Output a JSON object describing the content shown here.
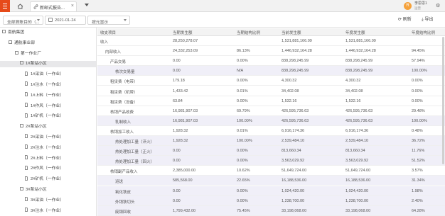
{
  "topbar": {
    "tab_label": "新邮式报告...",
    "user_name": "李思思1",
    "user_role": "运营",
    "avatar_text": "R",
    "accent": "#e64a19"
  },
  "filters": {
    "org_select": "全部算账目的（...",
    "date": "2021-01-24",
    "display_select": "按元显示",
    "refresh_label": "刷新",
    "export_label": "导出"
  },
  "tree": [
    {
      "label": "南航集团",
      "level": 0,
      "type": "box"
    },
    {
      "label": "通航事业部",
      "level": 1,
      "type": "box"
    },
    {
      "label": "第一作业厂",
      "level": 2,
      "type": "box"
    },
    {
      "label": "1#泵站小区",
      "level": 3,
      "type": "box",
      "selected": true
    },
    {
      "label": "1#采油（一作业）",
      "level": 4,
      "type": "doc"
    },
    {
      "label": "1#注水（一作业）",
      "level": 4,
      "type": "doc"
    },
    {
      "label": "1#上料（一作业）",
      "level": 4,
      "type": "doc"
    },
    {
      "label": "1#作风（一作业）",
      "level": 4,
      "type": "doc"
    },
    {
      "label": "1#矿机（一作业）",
      "level": 4,
      "type": "doc"
    },
    {
      "label": "2#泵站小区",
      "level": 3,
      "type": "box"
    },
    {
      "label": "2#采油（一作业）",
      "level": 4,
      "type": "doc"
    },
    {
      "label": "2#注水（一作业）",
      "level": 4,
      "type": "doc"
    },
    {
      "label": "2#上料（一作业）",
      "level": 4,
      "type": "doc"
    },
    {
      "label": "2#作风（一作业）",
      "level": 4,
      "type": "doc"
    },
    {
      "label": "2#矿机（一作业）",
      "level": 4,
      "type": "doc"
    },
    {
      "label": "3#泵站小区",
      "level": 3,
      "type": "box"
    },
    {
      "label": "3#采油（一作业）",
      "level": 4,
      "type": "doc"
    },
    {
      "label": "3#注水（一作业）",
      "level": 4,
      "type": "doc"
    }
  ],
  "table": {
    "headers": [
      "收支项目",
      "当期发生额",
      "当期结构比例",
      "当前发生额",
      "年度发生额",
      "年度结构比例"
    ],
    "rows": [
      {
        "level": 0,
        "cells": [
          "收入",
          "28,250,278.07",
          "",
          "1,531,881,166.09",
          "1,531,881,166.09",
          ""
        ]
      },
      {
        "level": 1,
        "cells": [
          "内部收入",
          "24,332,253.09",
          "86.13%",
          "1,446,932,164.28",
          "1,446,932,164.28",
          "94.45%"
        ]
      },
      {
        "level": 2,
        "cells": [
          "产品交易",
          "0.00",
          "0.00%",
          "838,298,245.99",
          "838,298,245.99",
          "57.94%"
        ]
      },
      {
        "level": 3,
        "cells": [
          "核次交易量",
          "0.00",
          "N/A",
          "838,298,245.99",
          "838,298,245.99",
          "100.00%"
        ]
      },
      {
        "level": 2,
        "cells": [
          "租赁费（电带）",
          "179.18",
          "0.00%",
          "4,300.32",
          "4,300.32",
          "0.00%"
        ]
      },
      {
        "level": 2,
        "cells": [
          "租赁费（机带）",
          "1,433.42",
          "0.01%",
          "34,402.08",
          "34,402.08",
          "0.00%"
        ]
      },
      {
        "level": 2,
        "cells": [
          "租赁费（设备）",
          "63.84",
          "0.00%",
          "1,532.16",
          "1,532.16",
          "0.00%"
        ]
      },
      {
        "level": 2,
        "cells": [
          "核销产品收费",
          "16,981,907.03",
          "69.79%",
          "426,595,736.63",
          "426,595,736.63",
          "29.48%"
        ]
      },
      {
        "level": 3,
        "cells": [
          "乳制收入",
          "16,981,907.03",
          "100.00%",
          "426,595,736.63",
          "426,595,736.63",
          "100.00%"
        ]
      },
      {
        "level": 2,
        "cells": [
          "核销加工收入",
          "1,928.32",
          "0.01%",
          "6,916,174.36",
          "6,916,174.36",
          "0.48%"
        ]
      },
      {
        "level": 3,
        "cells": [
          "热处理加工量（淬火）",
          "1,928.32",
          "100.00%",
          "2,539,484.10",
          "2,539,484.10",
          "36.72%"
        ]
      },
      {
        "level": 3,
        "cells": [
          "热处理加工量（正火）",
          "0.00",
          "0.00%",
          "813,660.34",
          "813,660.34",
          "11.76%"
        ]
      },
      {
        "level": 3,
        "cells": [
          "热处理加工量（回火）",
          "0.00",
          "0.00%",
          "3,563,029.92",
          "3,563,029.92",
          "51.52%"
        ]
      },
      {
        "level": 2,
        "cells": [
          "核销副产品收入",
          "2,385,000.00",
          "10.62%",
          "51,649,724.00",
          "51,649,724.00",
          "3.57%"
        ]
      },
      {
        "level": 3,
        "cells": [
          "运送",
          "585,568.00",
          "22.65%",
          "16,188,536.00",
          "16,188,536.00",
          "31.34%"
        ]
      },
      {
        "level": 3,
        "cells": [
          "氧化铁皮",
          "0.00",
          "0.00%",
          "1,024,420.00",
          "1,024,420.00",
          "1.98%"
        ]
      },
      {
        "level": 3,
        "cells": [
          "外销铁切头",
          "0.00",
          "0.00%",
          "1,238,700.00",
          "1,238,700.00",
          "2.40%"
        ]
      },
      {
        "level": 3,
        "cells": [
          "废钢回收",
          "1,799,432.00",
          "75.45%",
          "33,198,068.00",
          "33,198,068.00",
          "64.28%"
        ]
      }
    ]
  }
}
